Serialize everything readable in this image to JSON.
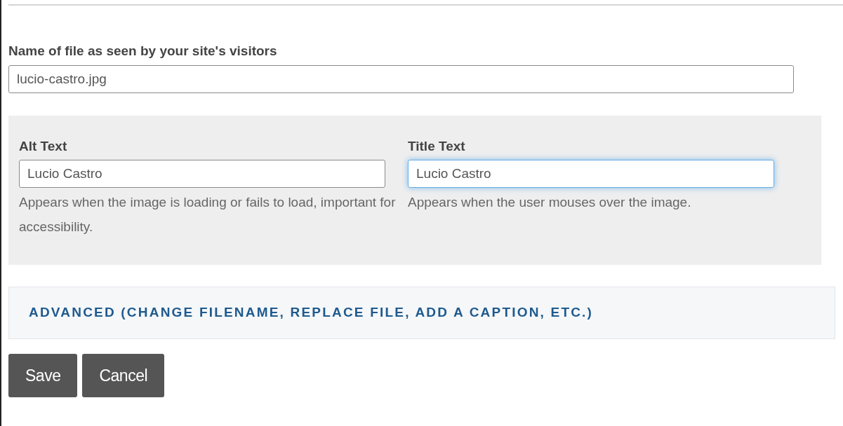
{
  "file_name": {
    "label": "Name of file as seen by your site's visitors",
    "value": "lucio-castro.jpg"
  },
  "text_fields": [
    {
      "label": "Alt Text",
      "value": "Lucio Castro",
      "focused": false,
      "help": "Appears when the image is loading or fails to load, important for accessibility."
    },
    {
      "label": "Title Text",
      "value": "Lucio Castro",
      "focused": true,
      "help": "Appears when the user mouses over the image."
    }
  ],
  "advanced": {
    "label": "ADVANCED (CHANGE FILENAME, REPLACE FILE, ADD A CAPTION, ETC.)"
  },
  "buttons": [
    "Save",
    "Cancel"
  ]
}
